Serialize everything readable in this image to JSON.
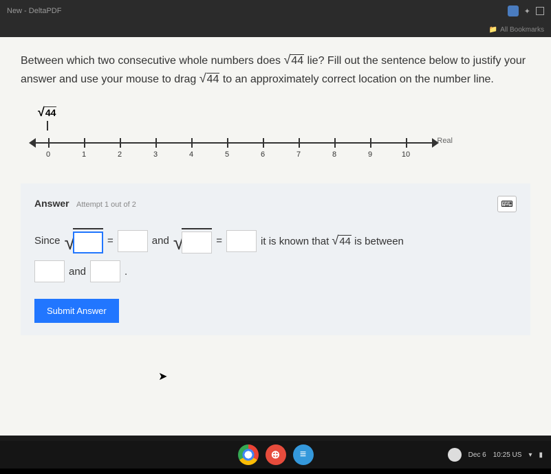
{
  "browser": {
    "tab": "New - DeltaPDF",
    "bookmarks_label": "All Bookmarks",
    "folder_icon": "folder-icon"
  },
  "question": {
    "prefix": "Between which two consecutive whole numbers does ",
    "sqrt_val_1": "44",
    "mid1": " lie? Fill out the sentence below to justify your answer and use your mouse to drag ",
    "sqrt_val_2": "44",
    "mid2": " to an approximately correct location on the number line."
  },
  "numberline": {
    "drag_label": "44",
    "ticks": [
      "0",
      "1",
      "2",
      "3",
      "4",
      "5",
      "6",
      "7",
      "8",
      "9",
      "10"
    ],
    "end_label": "Real"
  },
  "answer": {
    "title": "Answer",
    "attempt": "Attempt 1 out of 2",
    "text_since": "Since",
    "text_eq": "=",
    "text_and": "and",
    "text_known1": "it is known that ",
    "text_known_sqrt": "44",
    "text_known2": " is between",
    "text_and2": "and",
    "text_period": ".",
    "submit": "Submit Answer"
  },
  "taskbar": {
    "date": "Dec 6",
    "time": "10:25 US"
  }
}
